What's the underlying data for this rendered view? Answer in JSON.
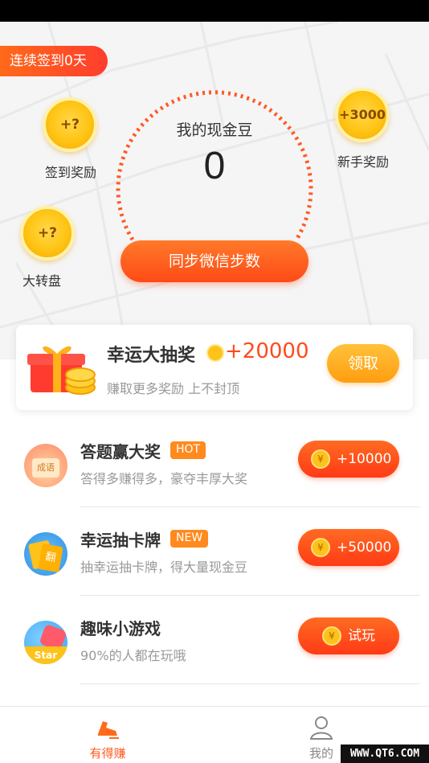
{
  "hero": {
    "streak_label": "连续签到0天",
    "checkin": {
      "coin_text": "+?",
      "label": "签到奖励"
    },
    "wheel": {
      "coin_text": "+?",
      "label": "大转盘"
    },
    "newbie": {
      "coin_text": "+3000",
      "label": "新手奖励"
    },
    "beans_title": "我的现金豆",
    "beans_value": "0",
    "sync_button": "同步微信步数"
  },
  "lottery": {
    "title": "幸运大抽奖",
    "amount": "+20000",
    "subtitle": "赚取更多奖励 上不封顶",
    "claim_button": "领取"
  },
  "tasks": [
    {
      "name": "答题赢大奖",
      "tag": "HOT",
      "desc": "答得多赚得多，豪夺丰厚大奖",
      "action": "+10000",
      "icon_text": "成语"
    },
    {
      "name": "幸运抽卡牌",
      "tag": "NEW",
      "desc": "抽幸运抽卡牌，得大量现金豆",
      "action": "+50000",
      "icon_text": "翻"
    },
    {
      "name": "趣味小游戏",
      "tag": "",
      "desc": "90%的人都在玩哦",
      "action": "试玩",
      "icon_text": "Star"
    }
  ],
  "coin_symbol": "¥",
  "tabbar": {
    "earn_label": "有得赚",
    "me_label": "我的"
  },
  "watermark": "WWW.QT6.COM",
  "colors": {
    "accent": "#ff4a1e",
    "orange": "#ff8a1e",
    "gold": "#ffc21a"
  }
}
